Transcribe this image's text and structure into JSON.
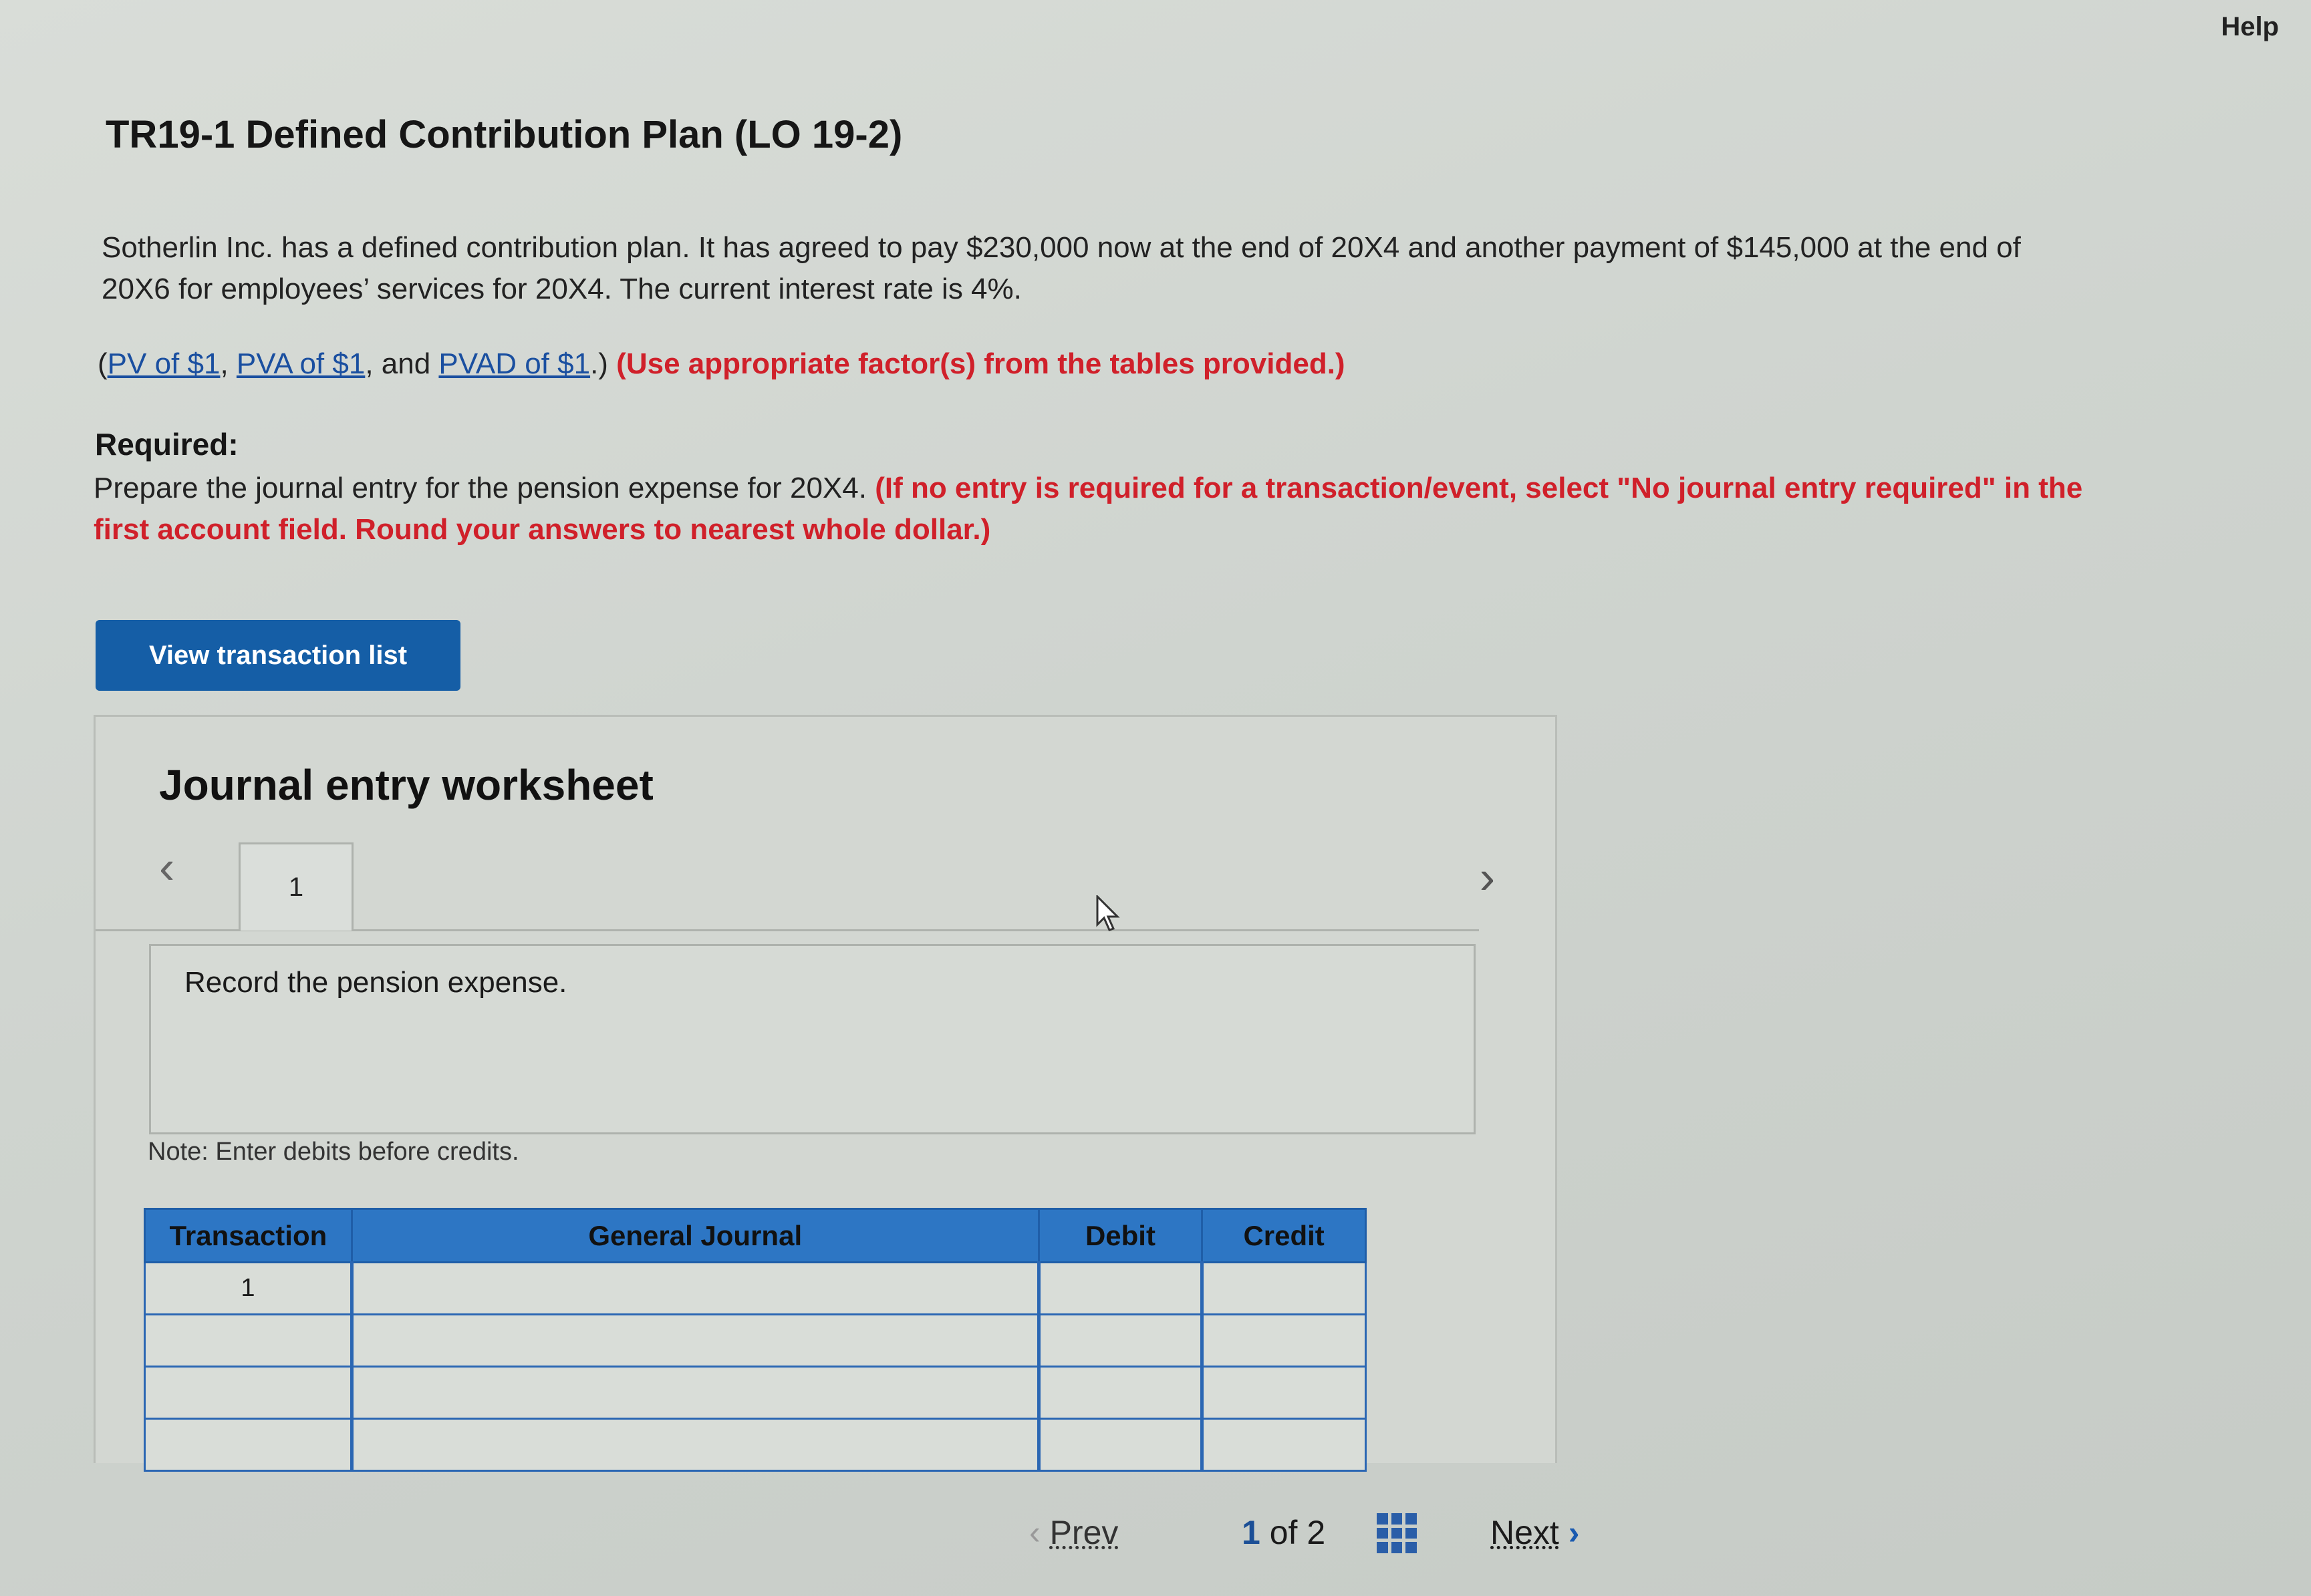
{
  "header": {
    "help_label": "Help"
  },
  "problem": {
    "title": "TR19-1 Defined Contribution Plan (LO 19-2)",
    "paragraph": "Sotherlin Inc. has a defined contribution plan. It has agreed to pay $230,000 now at the end of 20X4 and another payment of $145,000 at the end of 20X6 for employees’ services for 20X4. The current interest rate is 4%.",
    "links": {
      "open": "(",
      "pv": "PV of $1",
      "sep1": ", ",
      "pva": "PVA of $1",
      "sep2": ", and ",
      "pvad": "PVAD of $1",
      "close": ".) ",
      "instruction": "(Use appropriate factor(s) from the tables provided.)"
    },
    "required_label": "Required:",
    "required_text": "Prepare the journal entry for the pension expense for 20X4. ",
    "required_instruction": "(If no entry is required for a transaction/event, select \"No journal entry required\" in the first account field. Round your answers to nearest whole dollar.)"
  },
  "view_button_label": "View transaction list",
  "worksheet": {
    "title": "Journal entry worksheet",
    "tab_label": "1",
    "description": "Record the pension expense.",
    "note": "Note: Enter debits before credits.",
    "columns": [
      "Transaction",
      "General Journal",
      "Debit",
      "Credit"
    ],
    "rows": [
      {
        "transaction": "1",
        "account": "",
        "debit": "",
        "credit": ""
      },
      {
        "transaction": "",
        "account": "",
        "debit": "",
        "credit": ""
      },
      {
        "transaction": "",
        "account": "",
        "debit": "",
        "credit": ""
      },
      {
        "transaction": "",
        "account": "",
        "debit": "",
        "credit": ""
      }
    ]
  },
  "pager": {
    "prev_label": "Prev",
    "current": "1",
    "of_label": "of",
    "total": "2",
    "next_label": "Next"
  },
  "icons": {
    "nav_left": "chevron-left-icon",
    "nav_right": "chevron-right-icon",
    "grid": "grid-icon",
    "cursor": "mouse-cursor-icon"
  },
  "colors": {
    "primary_button": "#155ea6",
    "table_header": "#2d76c4",
    "instruction_red": "#d0202a",
    "link_blue": "#1a4fa0"
  }
}
